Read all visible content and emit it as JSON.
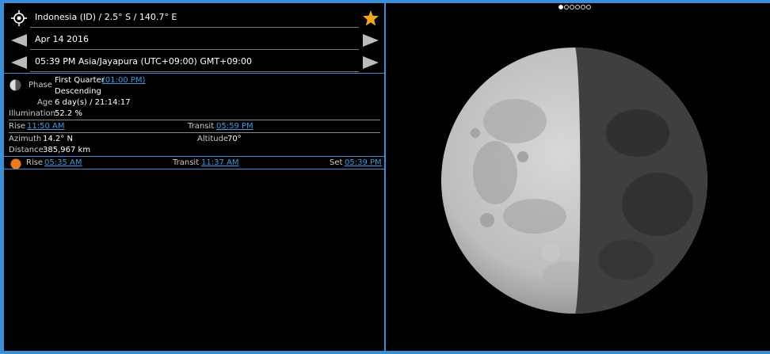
{
  "location": {
    "text": "Indonesia (ID)  /  2.5° S  /  140.7° E"
  },
  "date": {
    "text": "Apr 14 2016"
  },
  "time": {
    "text": "05:39 PM Asia/Jayapura (UTC+09:00) GMT+09:00"
  },
  "moon": {
    "phase_label": "Phase",
    "phase_name": "First Quarter",
    "phase_time": "(01:00 PM)",
    "trend": "Descending",
    "age_label": "Age",
    "age_value": "6 day(s) / 21:14:17",
    "illumination_label": "Illumination",
    "illumination_value": "52.2 %",
    "rise_label": "Rise",
    "rise_time": "11:50 AM",
    "transit_label": "Transit",
    "transit_time": "05:59 PM",
    "azimuth_label": "Azimuth",
    "azimuth_value": "14.2° N",
    "altitude_label": "Altitude",
    "altitude_value": "70°",
    "distance_label": "Distance",
    "distance_value": "385,967 km",
    "illumination_fraction": 0.522
  },
  "sun": {
    "rise_label": "Rise",
    "rise_time": "05:35 AM",
    "transit_label": "Transit",
    "transit_time": "11:37 AM",
    "set_label": "Set",
    "set_time": "05:39 PM"
  },
  "pager": {
    "count": 6,
    "active": 0
  },
  "colors": {
    "accent": "#3b8fd6",
    "link": "#3b9be0",
    "star": "#f5a623",
    "sun": "#f07a1a"
  },
  "icons": {
    "location": "crosshair-icon",
    "favorite": "star-icon",
    "prev": "left-arrow-icon",
    "next": "right-arrow-icon",
    "moon": "moon-phase-icon",
    "sun": "sun-icon"
  }
}
